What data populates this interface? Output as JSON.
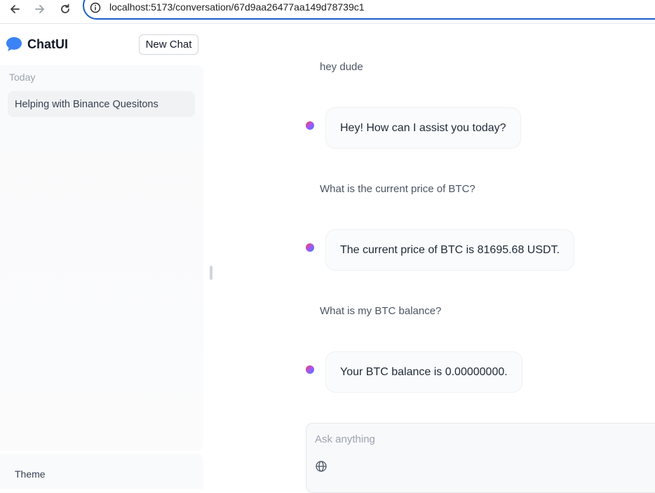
{
  "browser": {
    "url": "localhost:5173/conversation/67d9aa26477aa149d78739c1"
  },
  "sidebar": {
    "app_name": "ChatUI",
    "new_chat_label": "New Chat",
    "group_label": "Today",
    "conversations": [
      {
        "title": "Helping with Binance Quesitons"
      }
    ],
    "theme_label": "Theme"
  },
  "messages": [
    {
      "role": "user",
      "text": "hey dude"
    },
    {
      "role": "assistant",
      "text": "Hey! How can I assist you today?"
    },
    {
      "role": "user",
      "text": "What is the current price of BTC?"
    },
    {
      "role": "assistant",
      "text": "The current price of BTC is 81695.68 USDT."
    },
    {
      "role": "user",
      "text": "What is my BTC balance?"
    },
    {
      "role": "assistant",
      "text": "Your BTC balance is 0.00000000."
    }
  ],
  "composer": {
    "placeholder": "Ask anything",
    "value": ""
  },
  "colors": {
    "accent": "#3b82f6",
    "address_focus": "#1a5fc7"
  },
  "icons": [
    "back-icon",
    "forward-icon",
    "reload-icon",
    "info-icon",
    "chat-bubble-icon",
    "globe-icon"
  ]
}
